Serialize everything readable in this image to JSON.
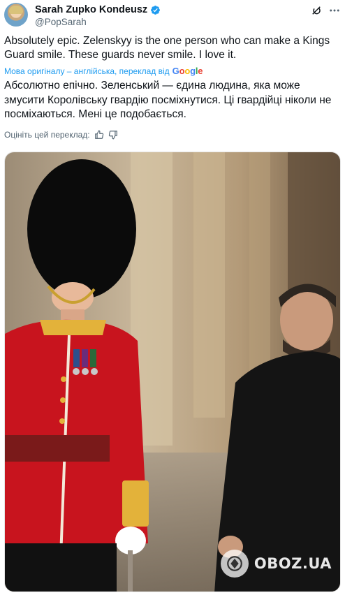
{
  "author": {
    "display_name": "Sarah Zupko Kondeusz",
    "handle": "@PopSarah",
    "verified": true
  },
  "icons": {
    "verified": "verified-badge-icon",
    "grok": "grok-icon",
    "more": "more-options-icon",
    "like": "thumbs-up-icon",
    "dislike": "thumbs-down-icon"
  },
  "tweet": {
    "text": "Absolutely epic. Zelenskyy is the one person who can make a Kings Guard smile. These guards never smile. I love it.",
    "translation_note": "Мова оригіналу – англійська, переклад від",
    "translation_provider": "Google",
    "translated_text": "Абсолютно епічно. Зеленський — єдина людина, яка може змусити Королівську гвардію посміхнутися. Ці гвардійці ніколи не посміхаються. Мені це подобається.",
    "rate_prompt": "Оцініть цей переклад:"
  },
  "media": {
    "watermark": "OBOZ.UA"
  },
  "colors": {
    "link": "#1d9bf0",
    "verified": "#1d9bf0",
    "text": "#0f1419",
    "secondary": "#536471",
    "guard_tunic": "#c8141e"
  }
}
